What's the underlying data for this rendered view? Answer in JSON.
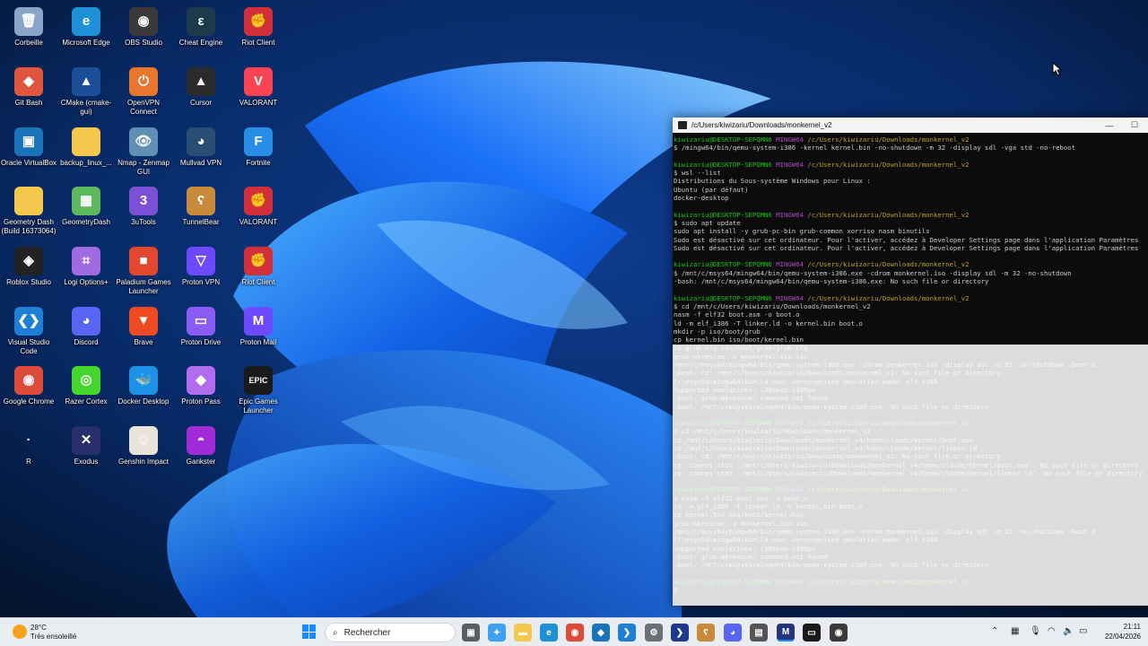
{
  "desktop": {
    "icons": [
      {
        "label": "Corbeille",
        "glyph": "🗑",
        "color": "#8aa4c8"
      },
      {
        "label": "Microsoft Edge",
        "glyph": "e",
        "color": "#1f8fd6"
      },
      {
        "label": "OBS Studio",
        "glyph": "◉",
        "color": "#3a3a3a"
      },
      {
        "label": "Cheat Engine",
        "glyph": "ε",
        "color": "#1d3a4d"
      },
      {
        "label": "Riot Client",
        "glyph": "✊",
        "color": "#d32f3a"
      },
      {
        "label": "Git Bash",
        "glyph": "◆",
        "color": "#e0553d"
      },
      {
        "label": "CMake (cmake-gui)",
        "glyph": "▲",
        "color": "#1b4f9a"
      },
      {
        "label": "OpenVPN Connect",
        "glyph": "⏻",
        "color": "#e8762c"
      },
      {
        "label": "Cursor",
        "glyph": "▲",
        "color": "#2b2b2b"
      },
      {
        "label": "VALORANT",
        "glyph": "V",
        "color": "#fa4454"
      },
      {
        "label": "Oracle VirtualBox",
        "glyph": "▣",
        "color": "#1b73b8"
      },
      {
        "label": "backup_linux_...",
        "glyph": "",
        "color": "#f2c94c"
      },
      {
        "label": "Nmap - Zenmap GUI",
        "glyph": "👁",
        "color": "#5f8fb3"
      },
      {
        "label": "Mullvad VPN",
        "glyph": "◕",
        "color": "#294d73"
      },
      {
        "label": "Fortnite",
        "glyph": "F",
        "color": "#2a8ee8"
      },
      {
        "label": "Geometry Dash (Build 16373064)",
        "glyph": "",
        "color": "#f2c94c"
      },
      {
        "label": "GeometryDash",
        "glyph": "▦",
        "color": "#5cb85c"
      },
      {
        "label": "3uTools",
        "glyph": "3",
        "color": "#7b4fd6"
      },
      {
        "label": "TunnelBear",
        "glyph": "ʕ",
        "color": "#c88a3b"
      },
      {
        "label": "VALORANT",
        "glyph": "✊",
        "color": "#d32f3a"
      },
      {
        "label": "Roblox Studio",
        "glyph": "◈",
        "color": "#222"
      },
      {
        "label": "Logi Options+",
        "glyph": "⌗",
        "color": "#a06be0"
      },
      {
        "label": "Paladium Games Launcher",
        "glyph": "■",
        "color": "#e3472d"
      },
      {
        "label": "Proton VPN",
        "glyph": "▽",
        "color": "#6d4aff"
      },
      {
        "label": "Riot Client",
        "glyph": "✊",
        "color": "#d32f3a"
      },
      {
        "label": "Visual Studio Code",
        "glyph": "❮❯",
        "color": "#1f7ed6"
      },
      {
        "label": "Discord",
        "glyph": "◕",
        "color": "#5865f2"
      },
      {
        "label": "Brave",
        "glyph": "▼",
        "color": "#f04a23"
      },
      {
        "label": "Proton Drive",
        "glyph": "▭",
        "color": "#8a5cf6"
      },
      {
        "label": "Proton Mail",
        "glyph": "M",
        "color": "#6d4aff"
      },
      {
        "label": "Google Chrome",
        "glyph": "◉",
        "color": "#dd4b39"
      },
      {
        "label": "Razer Cortex",
        "glyph": "◎",
        "color": "#44d62c"
      },
      {
        "label": "Docker Desktop",
        "glyph": "🐳",
        "color": "#1d91e6"
      },
      {
        "label": "Proton Pass",
        "glyph": "◆",
        "color": "#b26cf0"
      },
      {
        "label": "Epic Games Launcher",
        "glyph": "EPIC",
        "color": "#1a1a1a"
      },
      {
        "label": "R",
        "glyph": "·",
        "color": "transparent"
      },
      {
        "label": "Exodus",
        "glyph": "✕",
        "color": "#2a2f6b"
      },
      {
        "label": "Genshin Impact",
        "glyph": "☺",
        "color": "#e8e4da"
      },
      {
        "label": "Gankster",
        "glyph": "◓",
        "color": "#a12bd6"
      }
    ]
  },
  "terminal": {
    "title": "/c/Users/kiwizariu/Downloads/monkernel_v2",
    "lines": [
      {
        "t": "kiwizariu@DESKTOP-SEPQMN6 MINGW64 /c/Users/kiwizariu/Downloads/monkernel_v2",
        "k": "p"
      },
      {
        "t": "$ /mingw64/bin/qemu-system-i386 -kernel kernel.bin -no-shutdown -m 32 -display sdl -vga std -no-reboot",
        "k": "c"
      },
      {
        "t": "",
        "k": "c"
      },
      {
        "t": "kiwizariu@DESKTOP-SEPQMN6 MINGW64 /c/Users/kiwizariu/Downloads/monkernel_v2",
        "k": "p"
      },
      {
        "t": "$ wsl --list",
        "k": "c"
      },
      {
        "t": "Distributions du Sous-système Windows pour Linux :",
        "k": "c"
      },
      {
        "t": "Ubuntu (par défaut)",
        "k": "c"
      },
      {
        "t": "docker-desktop",
        "k": "c"
      },
      {
        "t": "",
        "k": "c"
      },
      {
        "t": "kiwizariu@DESKTOP-SEPQMN6 MINGW64 /c/Users/kiwizariu/Downloads/monkernel_v2",
        "k": "p"
      },
      {
        "t": "$ sudo apt update",
        "k": "c"
      },
      {
        "t": "sudo apt install -y grub-pc-bin grub-common xorriso nasm binutils",
        "k": "c"
      },
      {
        "t": "Sudo est désactivé sur cet ordinateur. Pour l'activer, accédez à Developer Settings page dans l'application Paramètres",
        "k": "c"
      },
      {
        "t": "Sudo est désactivé sur cet ordinateur. Pour l'activer, accédez à Developer Settings page dans l'application Paramètres",
        "k": "c"
      },
      {
        "t": "",
        "k": "c"
      },
      {
        "t": "kiwizariu@DESKTOP-SEPQMN6 MINGW64 /c/Users/kiwizariu/Downloads/monkernel_v2",
        "k": "p"
      },
      {
        "t": "$ /mnt/c/msys64/mingw64/bin/qemu-system-i386.exe -cdrom monkernel.iso -display sdl -m 32 -no-shutdown",
        "k": "c"
      },
      {
        "t": "-bash: /mnt/c/msys64/mingw64/bin/qemu-system-i386.exe: No such file or directory",
        "k": "c"
      },
      {
        "t": "",
        "k": "c"
      },
      {
        "t": "kiwizariu@DESKTOP-SEPQMN6 MINGW64 /c/Users/kiwizariu/Downloads/monkernel_v2",
        "k": "p"
      },
      {
        "t": "$ cd /mnt/c/Users/kiwizariu/Downloads/monkernel_v2",
        "k": "c"
      },
      {
        "t": "nasm -f elf32 boot.asm -o boot.o",
        "k": "c"
      },
      {
        "t": "ld -m elf_i386 -T linker.ld -o kernel.bin boot.o",
        "k": "c"
      },
      {
        "t": "mkdir -p iso/boot/grub",
        "k": "c"
      },
      {
        "t": "cp kernel.bin iso/boot/kernel.bin",
        "k": "c"
      },
      {
        "t": "cp grub.cfg iso/boot/grub/grub.cfg",
        "k": "c"
      },
      {
        "t": "grub-mkrescue -o monkernel.iso iso",
        "k": "c"
      },
      {
        "t": "/mnt/c/msys64/mingw64/bin/qemu-system-i386.exe -cdrom monkernel.iso -display sdl -m 32 -no-shutdown -boot d",
        "k": "c"
      },
      {
        "t": "-bash: cd: /mnt/c/Users/kiwizariu/Downloads/monkernel_v2: No such file or directory",
        "k": "c"
      },
      {
        "t": "C:\\msys64\\mingw64\\bin\\ld.exe: unrecognised emulation mode: elf_i386",
        "k": "c"
      },
      {
        "t": "Supported emulations: i386pep i386pe",
        "k": "c"
      },
      {
        "t": "-bash: grub-mkrescue: command not found",
        "k": "c"
      },
      {
        "t": "-bash: /mnt/c/msys64/mingw64/bin/qemu-system-i386.exe: No such file or directory",
        "k": "c"
      },
      {
        "t": "",
        "k": "c"
      },
      {
        "t": "kiwizariu@DESKTOP-SEPQMN6 MINGW64 /c/Users/kiwizariu/Downloads/monkernel_v2",
        "k": "p"
      },
      {
        "t": "$ cd /mnt/c/Users/kiwizariu/Downloads/monkernel_v2",
        "k": "c"
      },
      {
        "t": "cp /mnt/c/Users/kiwizariu/Downloads/monkernel_v4/home/claude/kernel/boot.asm .",
        "k": "c"
      },
      {
        "t": "cp /mnt/c/Users/kiwizariu/Downloads/monkernel_v4/home/claude/kernel/linker.ld .",
        "k": "c"
      },
      {
        "t": "-bash: cd: /mnt/c/Users/kiwizariu/Downloads/monkernel_v2: No such file or directory",
        "k": "c"
      },
      {
        "t": "cp: cannot stat '/mnt/c/Users/kiwizariu/Downloads/monkernel_v4/home/claude/kernel/boot.asm': No such file or directory",
        "k": "c"
      },
      {
        "t": "cp: cannot stat '/mnt/c/Users/kiwizariu/Downloads/monkernel_v4/home/claude/kernel/linker.ld': No such file or directory",
        "k": "c"
      },
      {
        "t": "",
        "k": "c"
      },
      {
        "t": "kiwizariu@DESKTOP-SEPQMN6 MINGW64 /c/Users/kiwizariu/Downloads/monkernel_v2",
        "k": "p"
      },
      {
        "t": "$ nasm -f elf32 boot.asm -o boot.o",
        "k": "c"
      },
      {
        "t": "ld -m elf_i386 -T linker.ld -o kernel.bin boot.o",
        "k": "c"
      },
      {
        "t": "cp kernel.bin iso/boot/kernel.bin",
        "k": "c"
      },
      {
        "t": "grub-mkrescue -o monkernel.iso iso",
        "k": "c"
      },
      {
        "t": "/mnt/c/msys64/mingw64/bin/qemu-system-i386.exe -cdrom monkernel.iso -display sdl -m 32 -no-shutdown -boot d",
        "k": "c"
      },
      {
        "t": "C:\\msys64\\mingw64\\bin\\ld.exe: unrecognised emulation mode: elf_i386",
        "k": "c"
      },
      {
        "t": "Supported emulations: i386pep i386pe",
        "k": "c"
      },
      {
        "t": "-bash: grub-mkrescue: command not found",
        "k": "c"
      },
      {
        "t": "-bash: /mnt/c/msys64/mingw64/bin/qemu-system-i386.exe: No such file or directory",
        "k": "c"
      },
      {
        "t": "",
        "k": "c"
      },
      {
        "t": "kiwizariu@DESKTOP-SEPQMN6 MINGW64 /c/Users/kiwizariu/Downloads/monkernel_v2",
        "k": "p"
      },
      {
        "t": "$",
        "k": "c"
      }
    ]
  },
  "taskbar": {
    "weather_temp": "28°C",
    "weather_desc": "Très ensoleillé",
    "search_placeholder": "Rechercher",
    "time": "21:11",
    "date": "22/04/2026"
  },
  "colors": {
    "prompt_user": "#16c60c",
    "prompt_host": "#b148c6",
    "prompt_path": "#c1a01e",
    "term_text": "#cccccc"
  }
}
